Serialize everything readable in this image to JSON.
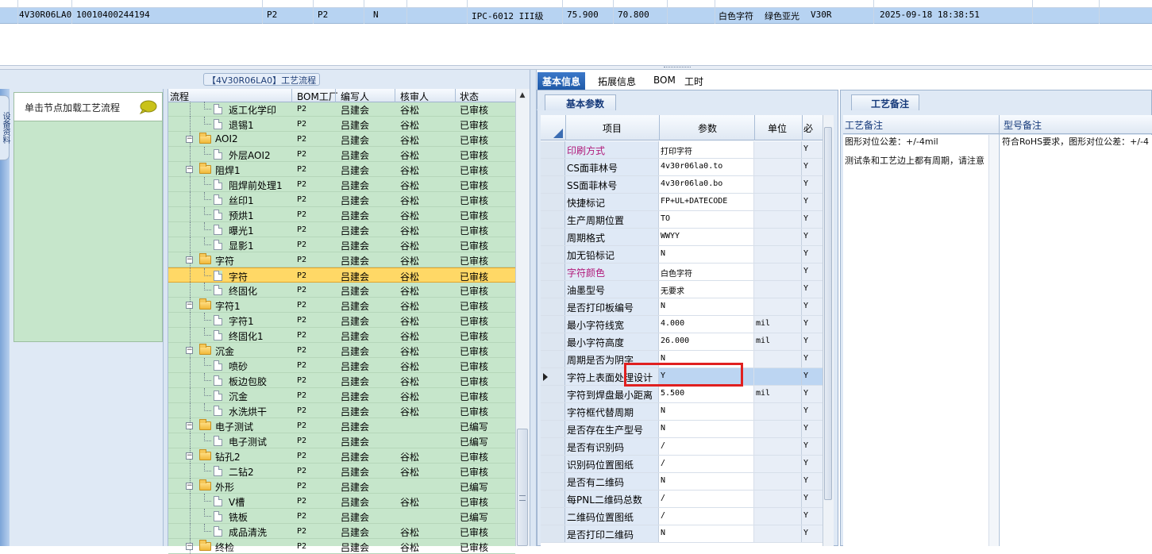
{
  "top_row": {
    "cells": [
      "4V30R06LA0",
      "10010400244194",
      "P2",
      "P2",
      "N",
      "IPC-6012 III级",
      "75.900",
      "70.800",
      "白色字符",
      "绿色亚光",
      "V30R",
      "2025-09-18 18:38:51"
    ]
  },
  "left": {
    "title": "【4V30R06LA0】工艺流程",
    "side_tab": "设备资料",
    "hint": "单击节点加载工艺流程"
  },
  "tree": {
    "headers": [
      "流程",
      "BOM工厂",
      "编写人",
      "核审人",
      "状态"
    ],
    "rows": [
      {
        "level": 2,
        "type": "doc",
        "name": "返工化学印",
        "bom": "P2",
        "writer": "吕建会",
        "reviewer": "谷松",
        "status": "已审核"
      },
      {
        "level": 2,
        "type": "doc",
        "name": "退锡1",
        "bom": "P2",
        "writer": "吕建会",
        "reviewer": "谷松",
        "status": "已审核"
      },
      {
        "level": 1,
        "type": "folder",
        "name": "AOI2",
        "bom": "P2",
        "writer": "吕建会",
        "reviewer": "谷松",
        "status": "已审核"
      },
      {
        "level": 2,
        "type": "doc",
        "name": "外层AOI2",
        "bom": "P2",
        "writer": "吕建会",
        "reviewer": "谷松",
        "status": "已审核"
      },
      {
        "level": 1,
        "type": "folder",
        "name": "阻焊1",
        "bom": "P2",
        "writer": "吕建会",
        "reviewer": "谷松",
        "status": "已审核"
      },
      {
        "level": 2,
        "type": "doc",
        "name": "阻焊前处理1",
        "bom": "P2",
        "writer": "吕建会",
        "reviewer": "谷松",
        "status": "已审核"
      },
      {
        "level": 2,
        "type": "doc",
        "name": "丝印1",
        "bom": "P2",
        "writer": "吕建会",
        "reviewer": "谷松",
        "status": "已审核"
      },
      {
        "level": 2,
        "type": "doc",
        "name": "预烘1",
        "bom": "P2",
        "writer": "吕建会",
        "reviewer": "谷松",
        "status": "已审核"
      },
      {
        "level": 2,
        "type": "doc",
        "name": "曝光1",
        "bom": "P2",
        "writer": "吕建会",
        "reviewer": "谷松",
        "status": "已审核"
      },
      {
        "level": 2,
        "type": "doc",
        "name": "显影1",
        "bom": "P2",
        "writer": "吕建会",
        "reviewer": "谷松",
        "status": "已审核"
      },
      {
        "level": 1,
        "type": "folder",
        "name": "字符",
        "bom": "P2",
        "writer": "吕建会",
        "reviewer": "谷松",
        "status": "已审核"
      },
      {
        "level": 2,
        "type": "doc",
        "name": "字符",
        "bom": "P2",
        "writer": "吕建会",
        "reviewer": "谷松",
        "status": "已审核",
        "selected": true
      },
      {
        "level": 2,
        "type": "doc",
        "name": "终固化",
        "bom": "P2",
        "writer": "吕建会",
        "reviewer": "谷松",
        "status": "已审核"
      },
      {
        "level": 1,
        "type": "folder",
        "name": "字符1",
        "bom": "P2",
        "writer": "吕建会",
        "reviewer": "谷松",
        "status": "已审核"
      },
      {
        "level": 2,
        "type": "doc",
        "name": "字符1",
        "bom": "P2",
        "writer": "吕建会",
        "reviewer": "谷松",
        "status": "已审核"
      },
      {
        "level": 2,
        "type": "doc",
        "name": "终固化1",
        "bom": "P2",
        "writer": "吕建会",
        "reviewer": "谷松",
        "status": "已审核"
      },
      {
        "level": 1,
        "type": "folder",
        "name": "沉金",
        "bom": "P2",
        "writer": "吕建会",
        "reviewer": "谷松",
        "status": "已审核"
      },
      {
        "level": 2,
        "type": "doc",
        "name": "喷砂",
        "bom": "P2",
        "writer": "吕建会",
        "reviewer": "谷松",
        "status": "已审核"
      },
      {
        "level": 2,
        "type": "doc",
        "name": "板边包胶",
        "bom": "P2",
        "writer": "吕建会",
        "reviewer": "谷松",
        "status": "已审核"
      },
      {
        "level": 2,
        "type": "doc",
        "name": "沉金",
        "bom": "P2",
        "writer": "吕建会",
        "reviewer": "谷松",
        "status": "已审核"
      },
      {
        "level": 2,
        "type": "doc",
        "name": "水洗烘干",
        "bom": "P2",
        "writer": "吕建会",
        "reviewer": "谷松",
        "status": "已审核"
      },
      {
        "level": 1,
        "type": "folder",
        "name": "电子测试",
        "bom": "P2",
        "writer": "吕建会",
        "reviewer": "",
        "status": "已编写"
      },
      {
        "level": 2,
        "type": "doc",
        "name": "电子测试",
        "bom": "P2",
        "writer": "吕建会",
        "reviewer": "",
        "status": "已编写"
      },
      {
        "level": 1,
        "type": "folder",
        "name": "钻孔2",
        "bom": "P2",
        "writer": "吕建会",
        "reviewer": "谷松",
        "status": "已审核"
      },
      {
        "level": 2,
        "type": "doc",
        "name": "二钻2",
        "bom": "P2",
        "writer": "吕建会",
        "reviewer": "谷松",
        "status": "已审核"
      },
      {
        "level": 1,
        "type": "folder",
        "name": "外形",
        "bom": "P2",
        "writer": "吕建会",
        "reviewer": "",
        "status": "已编写"
      },
      {
        "level": 2,
        "type": "doc",
        "name": "V槽",
        "bom": "P2",
        "writer": "吕建会",
        "reviewer": "谷松",
        "status": "已审核"
      },
      {
        "level": 2,
        "type": "doc",
        "name": "铣板",
        "bom": "P2",
        "writer": "吕建会",
        "reviewer": "",
        "status": "已编写"
      },
      {
        "level": 2,
        "type": "doc",
        "name": "成品清洗",
        "bom": "P2",
        "writer": "吕建会",
        "reviewer": "谷松",
        "status": "已审核"
      },
      {
        "level": 1,
        "type": "folder",
        "name": "终检",
        "bom": "P2",
        "writer": "吕建会",
        "reviewer": "谷松",
        "status": "已审核"
      }
    ]
  },
  "tabs": [
    "基本信息",
    "拓展信息",
    "BOM",
    "工时"
  ],
  "basic": {
    "tab": "基本参数",
    "headers": [
      "项目",
      "参数",
      "单位",
      "必"
    ],
    "rows": [
      {
        "item": "印刷方式",
        "param": "打印字符",
        "unit": "",
        "must": "Y",
        "pink": true
      },
      {
        "item": "CS面菲林号",
        "param": "4v30r06la0.to",
        "unit": "",
        "must": "Y"
      },
      {
        "item": "SS面菲林号",
        "param": "4v30r06la0.bo",
        "unit": "",
        "must": "Y"
      },
      {
        "item": "快捷标记",
        "param": "FP+UL+DATECODE",
        "unit": "",
        "must": "Y"
      },
      {
        "item": "生产周期位置",
        "param": "TO",
        "unit": "",
        "must": "Y"
      },
      {
        "item": "周期格式",
        "param": "WWYY",
        "unit": "",
        "must": "Y"
      },
      {
        "item": "加无铅标记",
        "param": "N",
        "unit": "",
        "must": "Y"
      },
      {
        "item": "字符颜色",
        "param": "白色字符",
        "unit": "",
        "must": "Y",
        "pink": true
      },
      {
        "item": "油墨型号",
        "param": "无要求",
        "unit": "",
        "must": "Y"
      },
      {
        "item": "是否打印板编号",
        "param": "N",
        "unit": "",
        "must": "Y"
      },
      {
        "item": "最小字符线宽",
        "param": "4.000",
        "unit": "mil",
        "must": "Y"
      },
      {
        "item": "最小字符高度",
        "param": "26.000",
        "unit": "mil",
        "must": "Y"
      },
      {
        "item": "周期是否为阴字",
        "param": "N",
        "unit": "",
        "must": "Y"
      },
      {
        "item": "字符上表面处理设计",
        "param": "Y",
        "unit": "",
        "must": "Y",
        "selected": true
      },
      {
        "item": "字符到焊盘最小距离",
        "param": "5.500",
        "unit": "mil",
        "must": "Y"
      },
      {
        "item": "字符框代替周期",
        "param": "N",
        "unit": "",
        "must": "Y"
      },
      {
        "item": "是否存在生产型号",
        "param": "N",
        "unit": "",
        "must": "Y"
      },
      {
        "item": "是否有识别码",
        "param": "/",
        "unit": "",
        "must": "Y"
      },
      {
        "item": "识别码位置图纸",
        "param": "/",
        "unit": "",
        "must": "Y"
      },
      {
        "item": "是否有二维码",
        "param": "N",
        "unit": "",
        "must": "Y"
      },
      {
        "item": "每PNL二维码总数",
        "param": "/",
        "unit": "",
        "must": "Y"
      },
      {
        "item": "二维码位置图纸",
        "param": "/",
        "unit": "",
        "must": "Y"
      },
      {
        "item": "是否打印二维码",
        "param": "N",
        "unit": "",
        "must": "Y"
      }
    ]
  },
  "remark": {
    "tab": "工艺备注",
    "headers": [
      "工艺备注",
      "型号备注"
    ],
    "process_note_line1": "图形对位公差：+/-4mil",
    "process_note_line2": "测试条和工艺边上都有周期，请注意",
    "model_note": "符合RoHS要求，图形对位公差：+/-4"
  }
}
